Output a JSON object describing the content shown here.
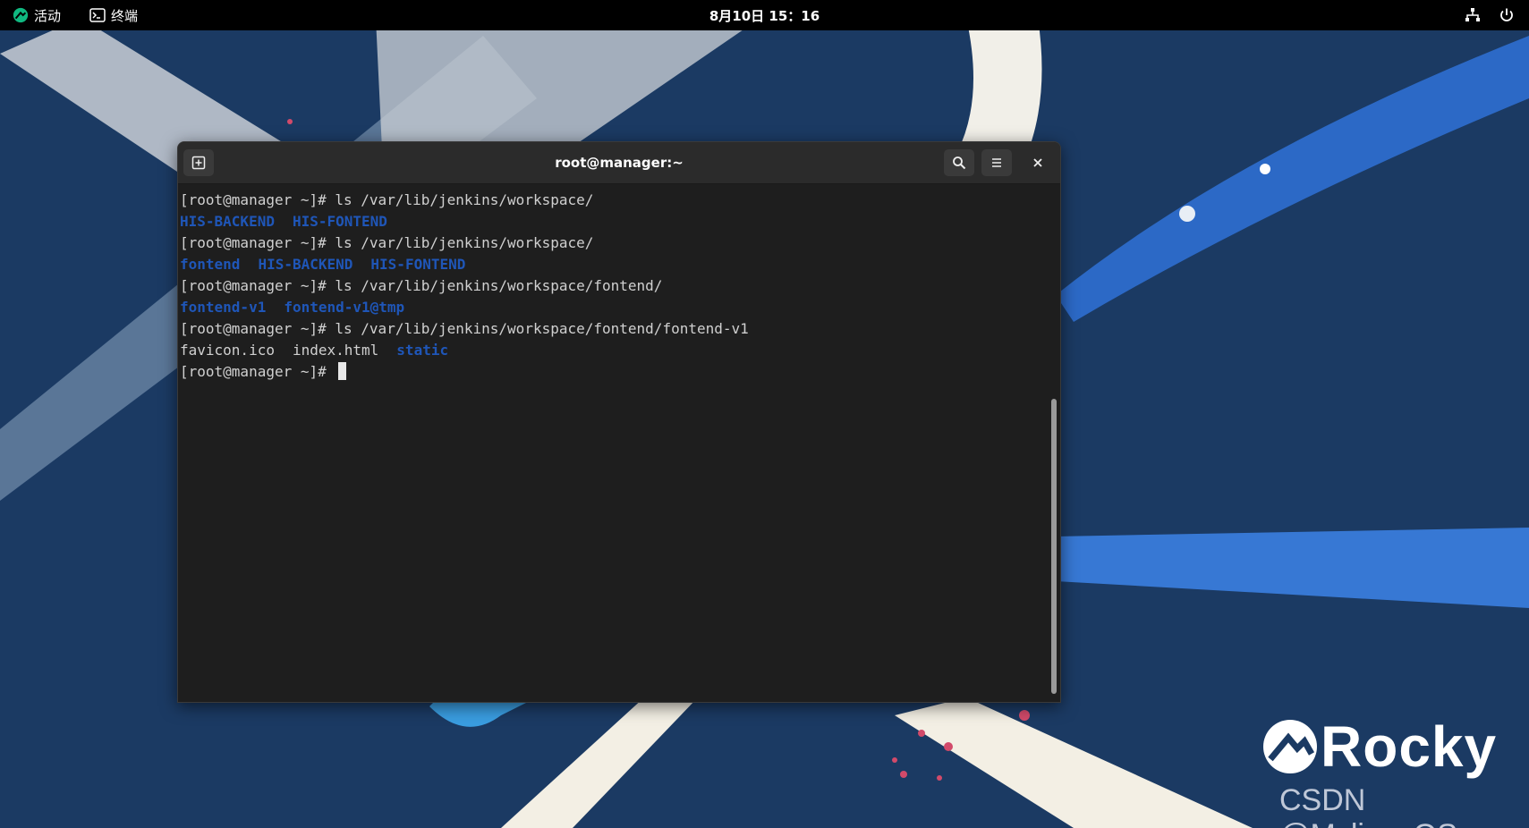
{
  "topbar": {
    "activities_label": "活动",
    "app_label": "终端",
    "clock": "8月10日  15：16"
  },
  "terminal": {
    "title": "root@manager:~",
    "lines": [
      {
        "segments": [
          {
            "text": "[root@manager ~]# ls /var/lib/jenkins/workspace/",
            "type": "plain"
          }
        ]
      },
      {
        "segments": [
          {
            "text": "HIS-BACKEND",
            "type": "dir"
          },
          {
            "text": "HIS-FONTEND",
            "type": "dir"
          }
        ]
      },
      {
        "segments": [
          {
            "text": "[root@manager ~]# ls /var/lib/jenkins/workspace/",
            "type": "plain"
          }
        ]
      },
      {
        "segments": [
          {
            "text": "fontend",
            "type": "dir"
          },
          {
            "text": "HIS-BACKEND",
            "type": "dir"
          },
          {
            "text": "HIS-FONTEND",
            "type": "dir"
          }
        ]
      },
      {
        "segments": [
          {
            "text": "[root@manager ~]# ls /var/lib/jenkins/workspace/fontend/",
            "type": "plain"
          }
        ]
      },
      {
        "segments": [
          {
            "text": "fontend-v1",
            "type": "dir"
          },
          {
            "text": "fontend-v1@tmp",
            "type": "dir"
          }
        ]
      },
      {
        "segments": [
          {
            "text": "[root@manager ~]# ls /var/lib/jenkins/workspace/fontend/fontend-v1",
            "type": "plain"
          }
        ]
      },
      {
        "segments": [
          {
            "text": "favicon.ico",
            "type": "plain"
          },
          {
            "text": "index.html",
            "type": "plain"
          },
          {
            "text": "static",
            "type": "dir"
          }
        ]
      },
      {
        "segments": [
          {
            "text": "[root@manager ~]# ",
            "type": "plain"
          }
        ],
        "cursor": true
      }
    ]
  },
  "wallpaper": {
    "logo_text": "Rocky",
    "watermark": "CSDN @MylinuxOS"
  },
  "colors": {
    "directory": "#1f56b8",
    "terminal_bg": "#1e1e1e",
    "desktop_bg": "#1b3a63"
  },
  "icons": {
    "activities": "rocky-logo-icon",
    "app": "terminal-icon",
    "network": "network-icon",
    "power": "power-icon",
    "new_tab": "new-tab-icon",
    "search": "search-icon",
    "menu": "hamburger-menu-icon",
    "close": "close-icon"
  }
}
